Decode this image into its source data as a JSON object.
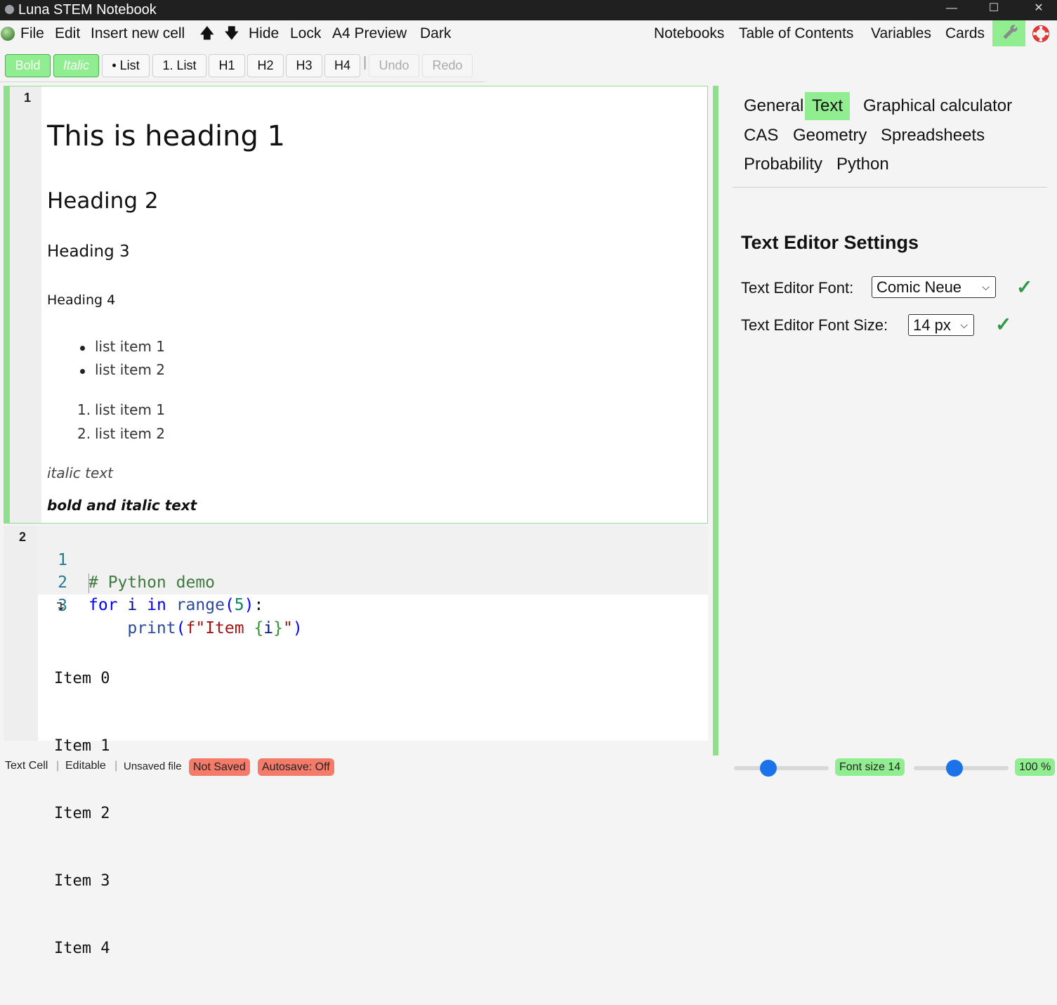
{
  "window": {
    "title": "Luna STEM Notebook",
    "minimize": "—",
    "maximize": "☐",
    "close": "✕"
  },
  "menu": {
    "left": [
      "File",
      "Edit",
      "Insert new cell",
      "🡅",
      "🡇",
      "Hide",
      "Lock",
      "A4 Preview",
      "Dark"
    ],
    "right": [
      "Notebooks",
      "Table of Contents",
      "Variables",
      "Cards"
    ],
    "settings_icon": "wrench-icon",
    "help_icon": "lifebuoy-icon"
  },
  "toolbar": {
    "bold": "Bold",
    "italic": "Italic",
    "bullet_list": "• List",
    "numbered_list": "1. List",
    "h1": "H1",
    "h2": "H2",
    "h3": "H3",
    "h4": "H4",
    "separator": "|",
    "undo": "Undo",
    "redo": "Redo"
  },
  "cells": {
    "text_cell": {
      "number": "1",
      "heading1": "This is heading 1",
      "heading2": "Heading 2",
      "heading3": "Heading 3",
      "heading4": "Heading 4",
      "bullets": [
        "list item 1",
        "list item 2"
      ],
      "numbered": [
        "list item 1",
        "list item 2"
      ],
      "numbered_markers": [
        "1.",
        "2."
      ],
      "italic": "italic text",
      "bold_italic": "bold and italic text"
    },
    "code_cell": {
      "number": "2",
      "line_numbers": [
        "1",
        "2",
        "3"
      ],
      "output_arrow": "↴",
      "output": [
        "Item 0",
        "Item 1",
        "Item 2",
        "Item 3",
        "Item 4"
      ]
    }
  },
  "settings": {
    "tabs": [
      "General",
      "Text",
      "Graphical calculator",
      "CAS",
      "Geometry",
      "Spreadsheets",
      "Probability",
      "Python"
    ],
    "active_tab": "Text",
    "title": "Text Editor Settings",
    "font_label": "Text Editor Font:",
    "font_value": "Comic Neue",
    "size_label": "Text Editor Font Size:",
    "size_value": "14 px",
    "check": "✓"
  },
  "status": {
    "cell_type": "Text Cell",
    "mode": "Editable",
    "file": "Unsaved file",
    "save_state": "Not Saved",
    "autosave": "Autosave: Off",
    "font_size": "Font size 14",
    "zoom": "100 %",
    "font_slider_level": 0.36,
    "zoom_slider_level": 0.43,
    "sep": "|"
  },
  "colors": {
    "accent": "#90ee90",
    "warning": "#f47a6a",
    "slider": "#1a73e8"
  }
}
